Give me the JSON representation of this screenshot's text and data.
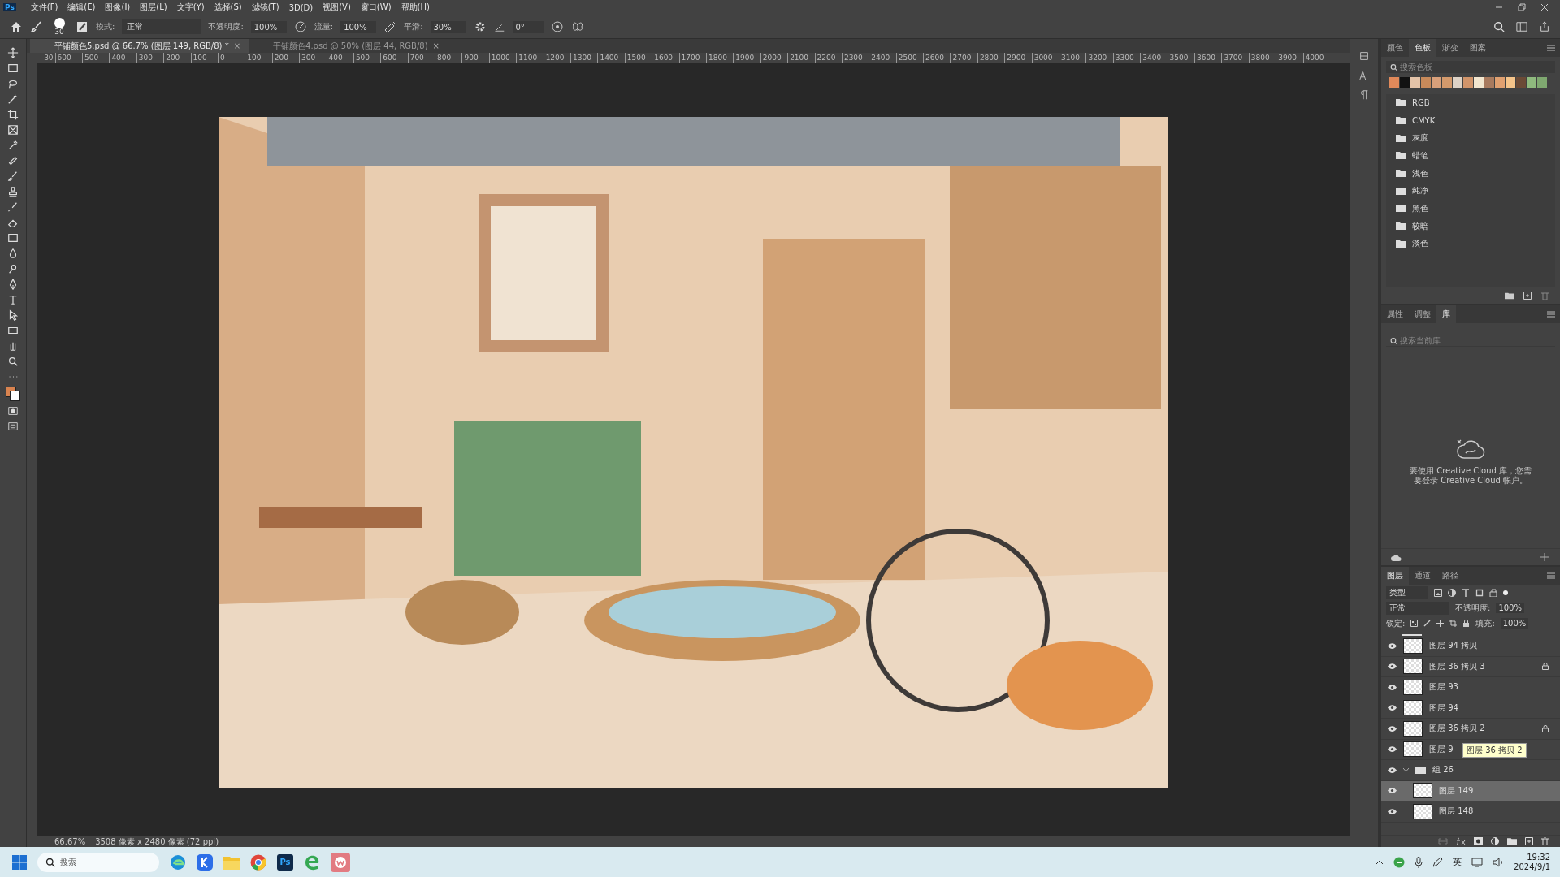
{
  "app_logo": "Ps",
  "menu": [
    "文件(F)",
    "编辑(E)",
    "图像(I)",
    "图层(L)",
    "文字(Y)",
    "选择(S)",
    "滤镜(T)",
    "3D(D)",
    "视图(V)",
    "窗口(W)",
    "帮助(H)"
  ],
  "options_bar": {
    "brush_size": "30",
    "mode_label": "模式:",
    "mode": "正常",
    "opacity_label": "不透明度:",
    "opacity": "100%",
    "flow_label": "流量:",
    "flow": "100%",
    "smoothing_label": "平滑:",
    "smoothing": "30%",
    "angle": "0°"
  },
  "documents": [
    {
      "title": "平铺颜色5.psd @ 66.7% (图层 149, RGB/8) *",
      "selected": true,
      "close_glyph": "×"
    },
    {
      "title": "平铺颜色4.psd @ 50% (图层 44, RGB/8)",
      "selected": false,
      "close_glyph": "×"
    }
  ],
  "ruler_labels": [
    "30",
    "600",
    "500",
    "400",
    "300",
    "200",
    "100",
    "0",
    "100",
    "200",
    "300",
    "400",
    "500",
    "600",
    "700",
    "800",
    "900",
    "1000",
    "1100",
    "1200",
    "1300",
    "1400",
    "1500",
    "1600",
    "1700",
    "1800",
    "1900",
    "2000",
    "2100",
    "2200",
    "2300",
    "2400",
    "2500",
    "2600",
    "2700",
    "2800",
    "2900",
    "3000",
    "3100",
    "3200",
    "3300",
    "3400",
    "3500",
    "3600",
    "3700",
    "3800",
    "3900",
    "4000"
  ],
  "toolbar": {
    "colors": [
      {
        "color": "#d9834f"
      },
      {
        "color": "#ffffff"
      }
    ]
  },
  "status_bar": {
    "zoom": "66.67%",
    "size": "3508 像素 x 2480 像素 (72 ppi)"
  },
  "swatches_panel": {
    "tabs": [
      {
        "label": "颜色",
        "selected": false
      },
      {
        "label": "色板",
        "selected": true
      },
      {
        "label": "渐变",
        "selected": false
      },
      {
        "label": "图案",
        "selected": false
      }
    ],
    "search_placeholder": "搜索色板",
    "swatches": [
      {
        "color": "#e0895a"
      },
      {
        "color": "#111111"
      },
      {
        "color": "#e3c3a8"
      },
      {
        "color": "#c88a5a"
      },
      {
        "color": "#d9a07a"
      },
      {
        "color": "#d49a6c"
      },
      {
        "color": "#ddd2c6"
      },
      {
        "color": "#d0946a"
      },
      {
        "color": "#f2e6cf"
      },
      {
        "color": "#a87a5e"
      },
      {
        "color": "#e0a070"
      },
      {
        "color": "#f5c48a"
      },
      {
        "color": "#6b4a36"
      },
      {
        "color": "#8fba7e"
      },
      {
        "color": "#7fa870"
      }
    ],
    "folders": [
      "RGB",
      "CMYK",
      "灰度",
      "蜡笔",
      "浅色",
      "纯净",
      "黑色",
      "较暗",
      "淡色"
    ]
  },
  "library_panel": {
    "tabs": [
      {
        "label": "属性",
        "selected": false
      },
      {
        "label": "调整",
        "selected": false
      },
      {
        "label": "库",
        "selected": true
      }
    ],
    "search_placeholder": "搜索当前库",
    "message": "要使用 Creative Cloud 库，您需要登录 Creative Cloud 帐户。"
  },
  "layers_panel": {
    "tabs": [
      {
        "label": "图层",
        "selected": true
      },
      {
        "label": "通道",
        "selected": false
      },
      {
        "label": "路径",
        "selected": false
      }
    ],
    "filter": "类型",
    "blend_mode": "正常",
    "opacity_label": "不透明度:",
    "opacity": "100%",
    "lock_label": "锁定:",
    "fill_label": "填充:",
    "fill": "100%",
    "layers": [
      {
        "kind": "layer",
        "name": "图层 94 拷贝",
        "visible": true,
        "locked": false,
        "selected": false
      },
      {
        "kind": "layer",
        "name": "图层 36 拷贝 3",
        "visible": true,
        "locked": true,
        "selected": false
      },
      {
        "kind": "layer",
        "name": "图层 93",
        "visible": true,
        "locked": false,
        "selected": false
      },
      {
        "kind": "layer",
        "name": "图层 94",
        "visible": true,
        "locked": false,
        "selected": false
      },
      {
        "kind": "layer",
        "name": "图层 36 拷贝 2",
        "visible": true,
        "locked": true,
        "selected": false
      },
      {
        "kind": "layer",
        "name": "图层 9",
        "visible": true,
        "locked": false,
        "selected": false
      },
      {
        "kind": "group",
        "name": "组 26",
        "visible": true,
        "expanded": true,
        "selected": false,
        "children": [
          {
            "kind": "layer",
            "name": "图层 149",
            "visible": true,
            "locked": false,
            "selected": true
          },
          {
            "kind": "layer",
            "name": "图层 148",
            "visible": true,
            "locked": false,
            "selected": false
          }
        ]
      }
    ],
    "tooltip": "图层 36 拷贝 2"
  },
  "taskbar": {
    "search_placeholder": "搜索",
    "ps_label": "Ps",
    "input_method": "英",
    "time": "19:32",
    "date": "2024/9/1"
  }
}
